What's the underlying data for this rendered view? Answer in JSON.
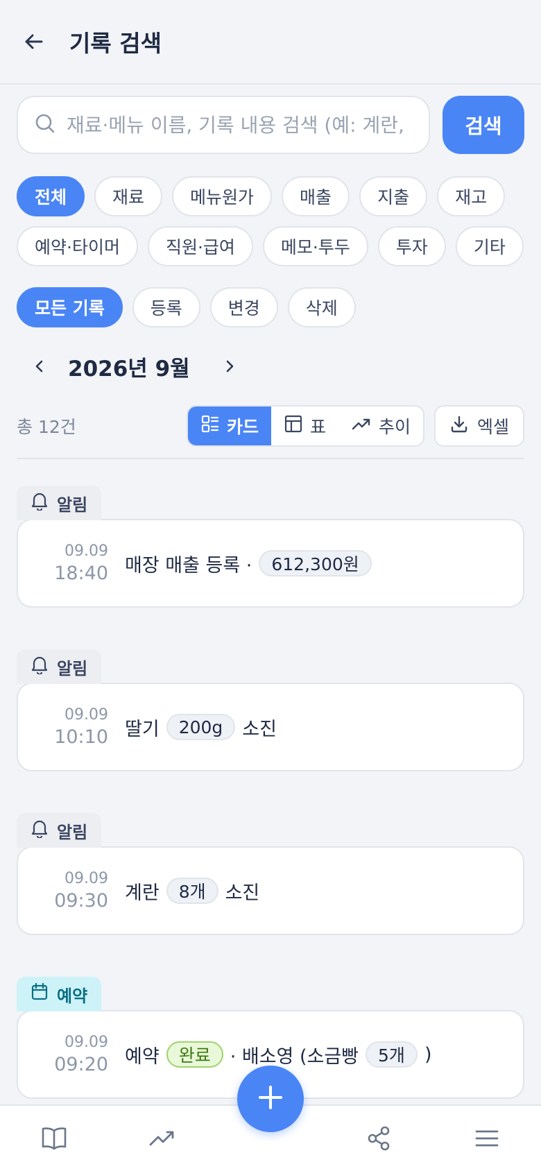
{
  "header": {
    "title": "기록 검색"
  },
  "search": {
    "placeholder": "재료·메뉴 이름, 기록 내용 검색 (예: 계란, 매출)",
    "button_label": "검색"
  },
  "categories": [
    "전체",
    "재료",
    "메뉴원가",
    "매출",
    "지출",
    "재고",
    "예약·타이머",
    "직원·급여",
    "메모·투두",
    "투자",
    "기타"
  ],
  "actions": [
    "모든 기록",
    "등록",
    "변경",
    "삭제"
  ],
  "month": {
    "label": "2026년 9월"
  },
  "toolbar": {
    "count": "총 12건",
    "views": [
      "카드",
      "표",
      "추이"
    ],
    "excel": "엑셀"
  },
  "entries": [
    {
      "tag": "알림",
      "date": "09.09",
      "time": "18:40",
      "text1": "매장 매출 등록 ·",
      "value": "612,300원",
      "text2": ""
    },
    {
      "tag": "알림",
      "date": "09.09",
      "time": "10:10",
      "text1": "딸기",
      "value": "200g",
      "text2": "소진"
    },
    {
      "tag": "알림",
      "date": "09.09",
      "time": "09:30",
      "text1": "계란",
      "value": "8개",
      "text2": "소진"
    },
    {
      "tag": "예약",
      "date": "09.09",
      "time": "09:20",
      "text1": "예약",
      "status": "완료",
      "text_mid": "· 배소영 (소금빵",
      "value": "5개",
      "text2": ")"
    }
  ],
  "colors": {
    "accent": "#4a85f6",
    "reserve_tag_bg": "#cdf3f8",
    "done_bg": "#e9f8d9"
  },
  "bottom_nav": [
    "book-icon",
    "trend-icon",
    "add-icon",
    "share-icon",
    "menu-icon"
  ]
}
